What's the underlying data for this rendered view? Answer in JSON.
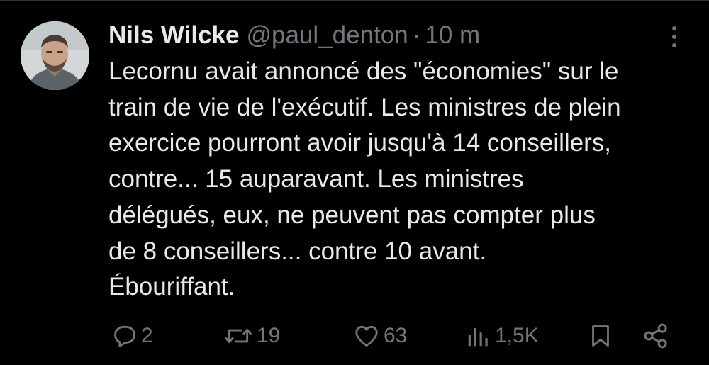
{
  "tweet": {
    "display_name": "Nils Wilcke",
    "handle": "@paul_denton",
    "separator": "·",
    "time": "10 m",
    "text_lines": [
      "Lecornu avait annoncé des \"économies\" sur le",
      "train de vie de l'exécutif. Les ministres de plein",
      "exercice pourront avoir jusqu'à 14 conseillers,",
      "contre... 15 auparavant. Les ministres",
      "délégués, eux, ne peuvent pas compter plus",
      "de 8 conseillers... contre 10 avant.",
      "Ébouriffant."
    ]
  },
  "actions": {
    "replies": "2",
    "reposts": "19",
    "likes": "63",
    "views": "1,5K"
  },
  "icons": {
    "reply": "reply-icon",
    "repost": "repost-icon",
    "like": "heart-icon",
    "views": "views-icon",
    "bookmark": "bookmark-icon",
    "share": "share-icon",
    "more": "more-icon"
  },
  "colors": {
    "background": "#000000",
    "text": "#e7e9ea",
    "muted": "#71767b"
  }
}
